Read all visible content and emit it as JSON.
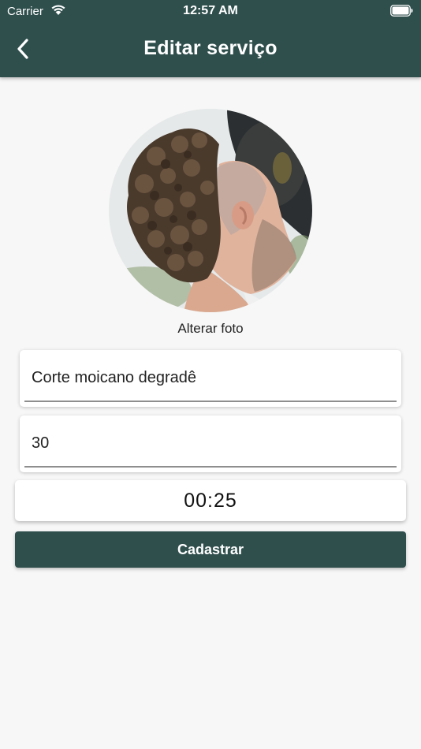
{
  "status_bar": {
    "carrier": "Carrier",
    "time": "12:57 AM",
    "wifi_icon": "wifi-icon",
    "battery_icon": "battery-icon"
  },
  "app_bar": {
    "title": "Editar serviço",
    "back_icon": "chevron-left-icon",
    "background_color": "#2f4f4d"
  },
  "photo": {
    "description": "service-photo",
    "change_label": "Alterar foto"
  },
  "form": {
    "name_value": "Corte moicano degradê",
    "price_value": "30",
    "duration_value": "00:25",
    "submit_label": "Cadastrar"
  },
  "colors": {
    "primary": "#2f4f4d",
    "background": "#f7f7f7"
  }
}
